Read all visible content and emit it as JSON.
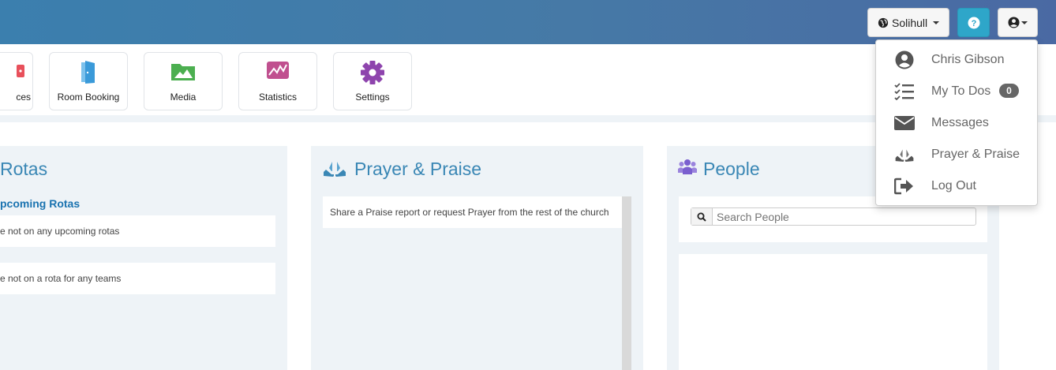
{
  "header": {
    "location_label": "Solihull",
    "help_label": "?"
  },
  "tiles": [
    {
      "label": "ces",
      "icon": "calendar-icon",
      "color": "#e8505b"
    },
    {
      "label": "Room Booking",
      "icon": "door-icon",
      "color": "#3a9ad9"
    },
    {
      "label": "Media",
      "icon": "image-icon",
      "color": "#4caf50"
    },
    {
      "label": "Statistics",
      "icon": "line-chart-icon",
      "color": "#c0508f"
    },
    {
      "label": "Settings",
      "icon": "gear-icon",
      "color": "#8e44ad"
    }
  ],
  "rotas": {
    "title": "Rotas",
    "upcoming_heading": "pcoming Rotas",
    "no_upcoming": "e not on any upcoming rotas",
    "no_teams": "e not on a rota for any teams"
  },
  "prayer": {
    "title": "Prayer & Praise",
    "description": "Share a Praise report or request Prayer from the rest of the church"
  },
  "people": {
    "title": "People",
    "search_placeholder": "Search People"
  },
  "user_menu": {
    "items": [
      {
        "label": "Chris Gibson",
        "icon": "user-circle-icon"
      },
      {
        "label": "My To Dos",
        "icon": "checklist-icon",
        "badge": "0"
      },
      {
        "label": "Messages",
        "icon": "envelope-icon"
      },
      {
        "label": "Prayer & Praise",
        "icon": "praying-hands-icon"
      },
      {
        "label": "Log Out",
        "icon": "sign-out-icon"
      }
    ]
  },
  "colors": {
    "header_start": "#3b7fae",
    "header_end": "#4a69a3",
    "accent_blue": "#3a87b5",
    "help_button": "#2ea6c9"
  }
}
